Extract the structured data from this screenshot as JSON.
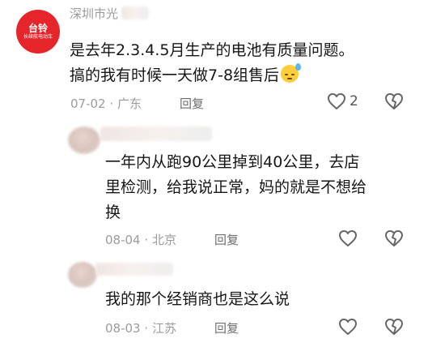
{
  "comments": [
    {
      "username": "深圳市光",
      "avatar_brand": "台铃",
      "avatar_brand_sub": "长续航电动车",
      "text_line1": "是去年2.3.4.5月生产的电池有质量问题。",
      "text_line2": "搞的我有时候一天做7-8组售后",
      "date": "07-02",
      "location": "广东",
      "reply_label": "回复",
      "like_count": "2"
    },
    {
      "text_line1": "一年内从跑90公里掉到40公里，去店",
      "text_line2": "里检测，给我说正常，妈的就是不想给",
      "text_line3": "换",
      "date": "08-04",
      "location": "北京",
      "reply_label": "回复"
    },
    {
      "text_line1": "我的那个经销商也是这么说",
      "date": "08-03",
      "location": "江苏",
      "reply_label": "回复"
    }
  ],
  "separator": "·",
  "colors": {
    "brand": "#e5252a",
    "meta": "#9b9b9b"
  },
  "icons": [
    "heart-icon",
    "dislike-heart-icon",
    "sweat-emoji-icon"
  ]
}
